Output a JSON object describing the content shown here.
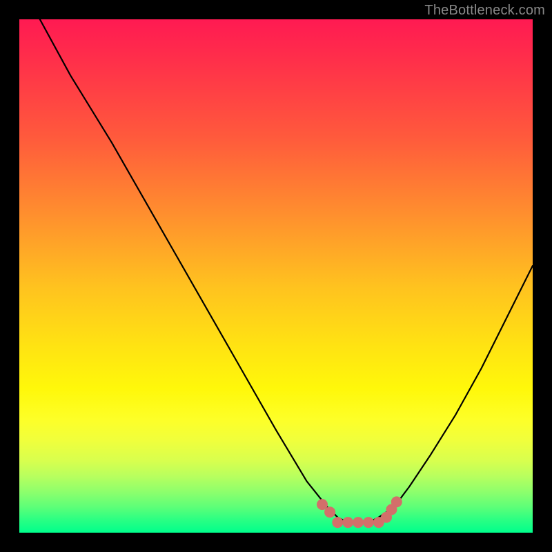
{
  "watermark": "TheBottleneck.com",
  "chart_data": {
    "type": "line",
    "title": "",
    "xlabel": "",
    "ylabel": "",
    "xlim": [
      0,
      100
    ],
    "ylim": [
      0,
      100
    ],
    "series": [
      {
        "name": "bottleneck-curve",
        "x": [
          4,
          10,
          18,
          26,
          34,
          42,
          50,
          56,
          60,
          62,
          64,
          66,
          68,
          70,
          73,
          76,
          80,
          85,
          90,
          95,
          100
        ],
        "values": [
          100,
          89,
          76,
          62,
          48,
          34,
          20,
          10,
          5,
          3,
          2,
          2,
          2,
          3,
          5,
          9,
          15,
          23,
          32,
          42,
          52
        ]
      }
    ],
    "highlight_region": {
      "name": "bottleneck-floor",
      "dots": [
        {
          "x": 59,
          "y": 5.5
        },
        {
          "x": 60.5,
          "y": 4
        },
        {
          "x": 62,
          "y": 2
        },
        {
          "x": 64,
          "y": 2
        },
        {
          "x": 66,
          "y": 2
        },
        {
          "x": 68,
          "y": 2
        },
        {
          "x": 70,
          "y": 2
        },
        {
          "x": 71.5,
          "y": 3
        },
        {
          "x": 72.5,
          "y": 4.5
        },
        {
          "x": 73.5,
          "y": 6
        }
      ],
      "color": "#d36f6a"
    },
    "gradient_description": "vertical heatmap red-to-green indicating bottleneck severity (red=high, green=low)"
  }
}
